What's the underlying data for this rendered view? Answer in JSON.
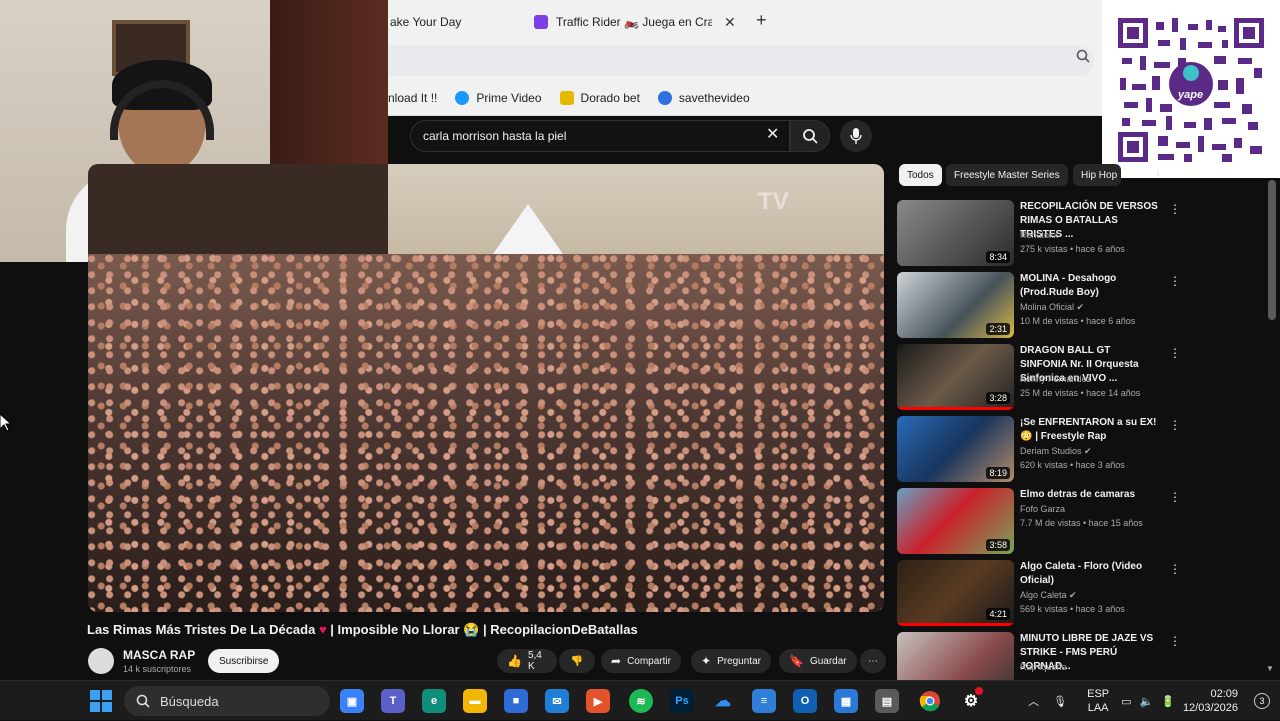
{
  "browser": {
    "tabs": [
      {
        "label": "ake Your Day"
      },
      {
        "label": "Traffic Rider 🏍️ Juega en Crazy"
      }
    ],
    "new_tab": "+",
    "bookmarks": [
      {
        "label": "nload It !!"
      },
      {
        "label": "Prime Video",
        "icon": "prime-video-icon",
        "color": "#1a98ff"
      },
      {
        "label": "Dorado bet",
        "icon": "dorado-bet-icon",
        "color": "#e6b800"
      },
      {
        "label": "savethevideo",
        "icon": "savethevideo-icon",
        "color": "#2f6fe0"
      }
    ]
  },
  "youtube": {
    "search_query": "carla morrison hasta la piel",
    "video": {
      "title_part1": "Las Rimas Más Tristes De La Década",
      "title_part2": " | Imposible No Llorar",
      "title_part3": " | RecopilacionDeBatallas",
      "channel": "MASCA RAP",
      "subscribers": "14 k suscriptores",
      "subscribe_label": "Suscribirse",
      "likes": "5,4 K",
      "share_label": "Compartir",
      "ask_label": "Preguntar",
      "save_label": "Guardar",
      "watermark": "TV"
    },
    "chips": [
      "Todos",
      "Freestyle Master Series",
      "Hip Hop"
    ],
    "recommendations": [
      {
        "title": "RECOPILACIÓN DE VERSOS RIMAS O BATALLAS TRISTES ...",
        "channel": "Renatoxx",
        "meta": "275 k vistas • hace 6 años",
        "duration": "8:34",
        "progress": 0
      },
      {
        "title": "MOLINA - Desahogo (Prod.Rude Boy)",
        "channel": "Molina Oficial",
        "meta": "10 M de vistas • hace 6 años",
        "duration": "2:31",
        "progress": 0
      },
      {
        "title": "DRAGON BALL GT SINFONIA Nr. II Orquesta Sinfonica en VIVO ...",
        "channel": "Kenny Fernandez",
        "meta": "25 M de vistas • hace 14 años",
        "duration": "3:28",
        "progress": 1.0
      },
      {
        "title": "¡Se ENFRENTARON a su EX! 😳 | Freestyle Rap",
        "channel": "Deriam Studios",
        "meta": "620 k vistas • hace 3 años",
        "duration": "8:19",
        "progress": 0
      },
      {
        "title": "Elmo detras de camaras",
        "channel": "Fofo Garza",
        "meta": "7.7 M de vistas • hace 15 años",
        "duration": "3:58",
        "progress": 0
      },
      {
        "title": "Algo Caleta - Floro (Video Oficial)",
        "channel": "Algo Caleta",
        "meta": "569 k vistas • hace 3 años",
        "duration": "4:21",
        "progress": 1.0
      },
      {
        "title": "MINUTO LIBRE DE JAZE VS STRIKE - FMS PERÚ JORNAD...",
        "channel": "Rap Iqueño",
        "meta": "",
        "duration": "",
        "progress": 0
      }
    ]
  },
  "taskbar": {
    "search_label": "Búsqueda",
    "lang_line1": "ESP",
    "lang_line2": "LAA",
    "time": "02:09",
    "date": "12/03/2026",
    "notifications": "3"
  }
}
